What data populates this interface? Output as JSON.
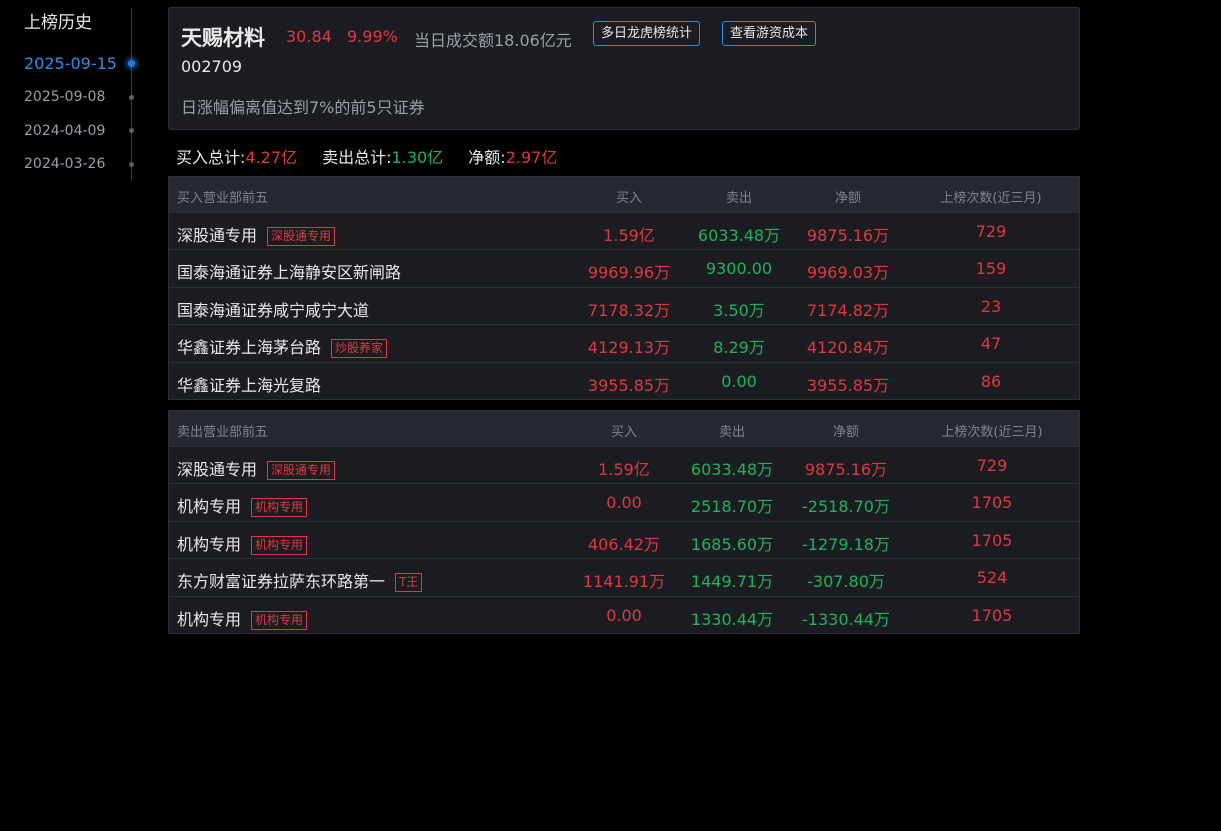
{
  "sidebar": {
    "title": "上榜历史",
    "dates": [
      "2025-09-15",
      "2025-09-08",
      "2024-04-09",
      "2024-03-26"
    ],
    "active_index": 0
  },
  "stock": {
    "name": "天赐材料",
    "price": "30.84",
    "change_pct": "9.99%",
    "turnover": "当日成交额18.06亿元",
    "code": "002709",
    "reason": "日涨幅偏离值达到7%的前5只证券",
    "buttons": {
      "lhb_stats": "多日龙虎榜统计",
      "youzi_cost": "查看游资成本"
    }
  },
  "totals": {
    "buy_label": "买入总计:",
    "buy_value": "4.27亿",
    "sell_label": "卖出总计:",
    "sell_value": "1.30亿",
    "net_label": "净额:",
    "net_value": "2.97亿"
  },
  "buy_table": {
    "headers": {
      "name": "买入营业部前五",
      "buy": "买入",
      "sell": "卖出",
      "net": "净额",
      "count": "上榜次数(近三月)"
    },
    "rows": [
      {
        "name": "深股通专用",
        "tag": "深股通专用",
        "buy": "1.59亿",
        "sell": "6033.48万",
        "net": "9875.16万",
        "count": "729"
      },
      {
        "name": "国泰海通证券上海静安区新闸路",
        "tag": "",
        "buy": "9969.96万",
        "sell": "9300.00",
        "net": "9969.03万",
        "count": "159"
      },
      {
        "name": "国泰海通证券咸宁咸宁大道",
        "tag": "",
        "buy": "7178.32万",
        "sell": "3.50万",
        "net": "7174.82万",
        "count": "23"
      },
      {
        "name": "华鑫证券上海茅台路",
        "tag": "炒股养家",
        "buy": "4129.13万",
        "sell": "8.29万",
        "net": "4120.84万",
        "count": "47"
      },
      {
        "name": "华鑫证券上海光复路",
        "tag": "",
        "buy": "3955.85万",
        "sell": "0.00",
        "net": "3955.85万",
        "count": "86"
      }
    ]
  },
  "sell_table": {
    "headers": {
      "name": "卖出营业部前五",
      "buy": "买入",
      "sell": "卖出",
      "net": "净额",
      "count": "上榜次数(近三月)"
    },
    "rows": [
      {
        "name": "深股通专用",
        "tag": "深股通专用",
        "buy": "1.59亿",
        "sell": "6033.48万",
        "net": "9875.16万",
        "count": "729",
        "net_negative": false
      },
      {
        "name": "机构专用",
        "tag": "机构专用",
        "buy": "0.00",
        "sell": "2518.70万",
        "net": "-2518.70万",
        "count": "1705",
        "net_negative": true
      },
      {
        "name": "机构专用",
        "tag": "机构专用",
        "buy": "406.42万",
        "sell": "1685.60万",
        "net": "-1279.18万",
        "count": "1705",
        "net_negative": true
      },
      {
        "name": "东方财富证券拉萨东环路第一",
        "tag": "T王",
        "buy": "1141.91万",
        "sell": "1449.71万",
        "net": "-307.80万",
        "count": "524",
        "net_negative": true
      },
      {
        "name": "机构专用",
        "tag": "机构专用",
        "buy": "0.00",
        "sell": "1330.44万",
        "net": "-1330.44万",
        "count": "1705",
        "net_negative": true
      }
    ]
  },
  "colors": {
    "up": "#e0383e",
    "down": "#1fb35a",
    "accent": "#2f8fe8",
    "panel": "#1b1d22",
    "header": "#262931"
  }
}
